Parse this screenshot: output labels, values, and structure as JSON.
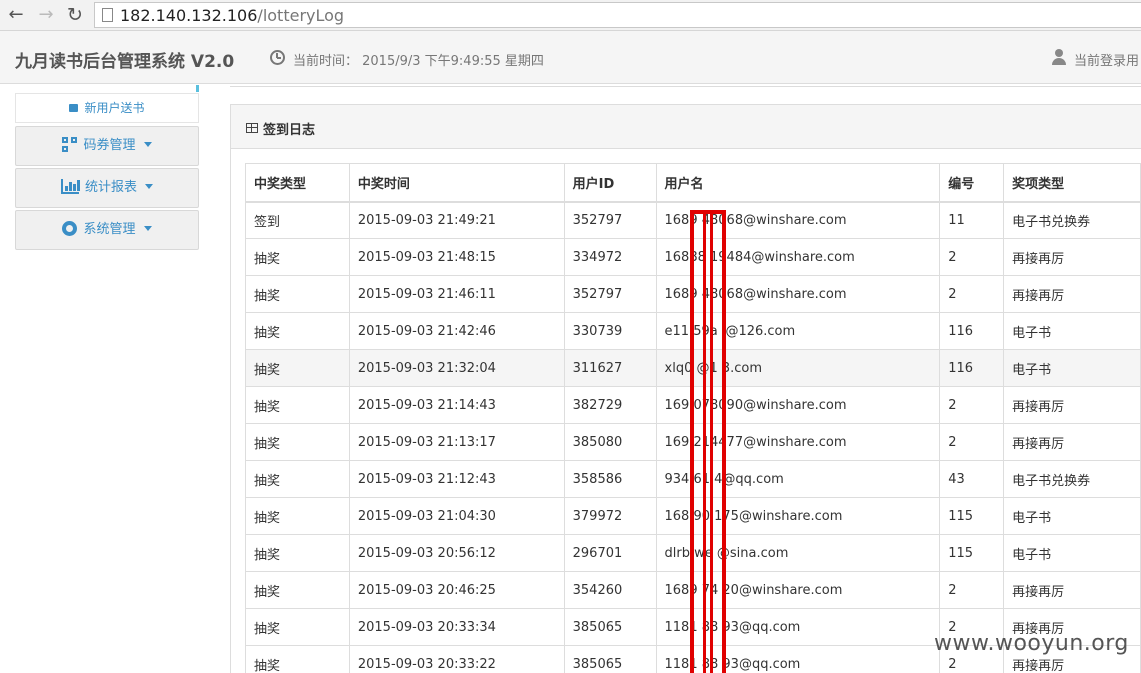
{
  "browser": {
    "url_host": "182.140.132.106",
    "url_path": "/lotteryLog"
  },
  "header": {
    "app_title": "九月读书后台管理系统 V2.0",
    "time_label": "当前时间： 2015/9/3 下午9:49:55 星期四",
    "login_label": "当前登录用"
  },
  "sidebar": {
    "sub_item": "新用户送书",
    "menus": [
      {
        "label": "码券管理",
        "icon": "qr-icon"
      },
      {
        "label": "统计报表",
        "icon": "bar-chart-icon"
      },
      {
        "label": "系统管理",
        "icon": "gear-icon"
      }
    ]
  },
  "panel": {
    "title": "签到日志"
  },
  "table": {
    "columns": [
      "中奖类型",
      "中奖时间",
      "用户ID",
      "用户名",
      "编号",
      "奖项类型"
    ],
    "rows": [
      [
        "签到",
        "2015-09-03 21:49:21",
        "352797",
        "1689 48068@winshare.com",
        "11",
        "电子书兑换券"
      ],
      [
        "抽奖",
        "2015-09-03 21:48:15",
        "334972",
        "16888 19484@winshare.com",
        "2",
        "再接再厉"
      ],
      [
        "抽奖",
        "2015-09-03 21:46:11",
        "352797",
        "1689 48068@winshare.com",
        "2",
        "再接再厉"
      ],
      [
        "抽奖",
        "2015-09-03 21:42:46",
        "330739",
        "e11 59a l@126.com",
        "116",
        "电子书"
      ],
      [
        "抽奖",
        "2015-09-03 21:32:04",
        "311627",
        "xlq0 @1 3.com",
        "116",
        "电子书"
      ],
      [
        "抽奖",
        "2015-09-03 21:14:43",
        "382729",
        "169 078090@winshare.com",
        "2",
        "再接再厉"
      ],
      [
        "抽奖",
        "2015-09-03 21:13:17",
        "385080",
        "169 214477@winshare.com",
        "2",
        "再接再厉"
      ],
      [
        "抽奖",
        "2015-09-03 21:12:43",
        "358586",
        "934 61 4@qq.com",
        "43",
        "电子书兑换券"
      ],
      [
        "抽奖",
        "2015-09-03 21:04:30",
        "379972",
        "168 90 175@winshare.com",
        "115",
        "电子书"
      ],
      [
        "抽奖",
        "2015-09-03 20:56:12",
        "296701",
        "dlrb we @sina.com",
        "115",
        "电子书"
      ],
      [
        "抽奖",
        "2015-09-03 20:46:25",
        "354260",
        "1689 74 20@winshare.com",
        "2",
        "再接再厉"
      ],
      [
        "抽奖",
        "2015-09-03 20:33:34",
        "385065",
        "1181 88 93@qq.com",
        "2",
        "再接再厉"
      ],
      [
        "抽奖",
        "2015-09-03 20:33:22",
        "385065",
        "1181 88 93@qq.com",
        "2",
        "再接再厉"
      ]
    ],
    "highlighted_row": 4
  },
  "watermark": "www.wooyun.org",
  "colors": {
    "accent": "#3a8ec6",
    "redaction": "#e00000"
  }
}
